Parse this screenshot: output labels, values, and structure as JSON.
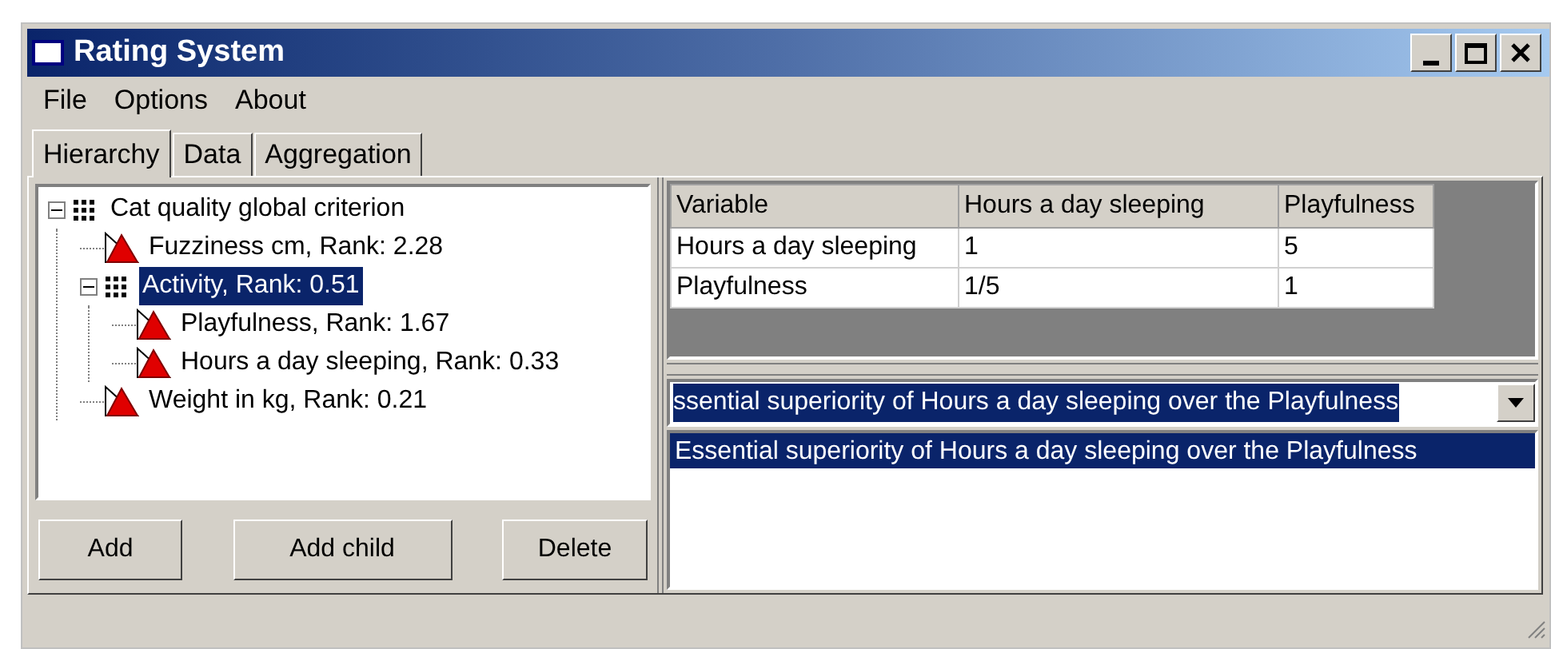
{
  "window": {
    "title": "Rating System"
  },
  "menu": [
    "File",
    "Options",
    "About"
  ],
  "tabs": [
    {
      "label": "Hierarchy",
      "selected": true
    },
    {
      "label": "Data",
      "selected": false
    },
    {
      "label": "Aggregation",
      "selected": false
    }
  ],
  "tree": [
    {
      "label": "Cat quality global criterion",
      "kind": "group",
      "expanded": true,
      "selected": false,
      "children": [
        {
          "label": "Fuzziness cm, Rank: 2.28",
          "kind": "leaf",
          "selected": false
        },
        {
          "label": "Activity, Rank: 0.51",
          "kind": "group",
          "expanded": true,
          "selected": true,
          "children": [
            {
              "label": "Playfulness, Rank: 1.67",
              "kind": "leaf",
              "selected": false
            },
            {
              "label": "Hours a day sleeping, Rank: 0.33",
              "kind": "leaf",
              "selected": false
            }
          ]
        },
        {
          "label": "Weight in kg, Rank: 0.21",
          "kind": "leaf",
          "selected": false
        }
      ]
    }
  ],
  "buttons": [
    "Add",
    "Add child",
    "Delete"
  ],
  "table": {
    "columns": [
      "Variable",
      "Hours a day sleeping",
      "Playfulness"
    ],
    "rows": [
      [
        "Hours a day sleeping",
        "1",
        "5"
      ],
      [
        "Playfulness",
        "1/5",
        "1"
      ]
    ]
  },
  "combo": {
    "value": "ssential superiority of Hours a day sleeping over the Playfulness"
  },
  "list": [
    {
      "label": "Essential superiority of Hours a day sleeping over the Playfulness",
      "selected": true
    }
  ]
}
